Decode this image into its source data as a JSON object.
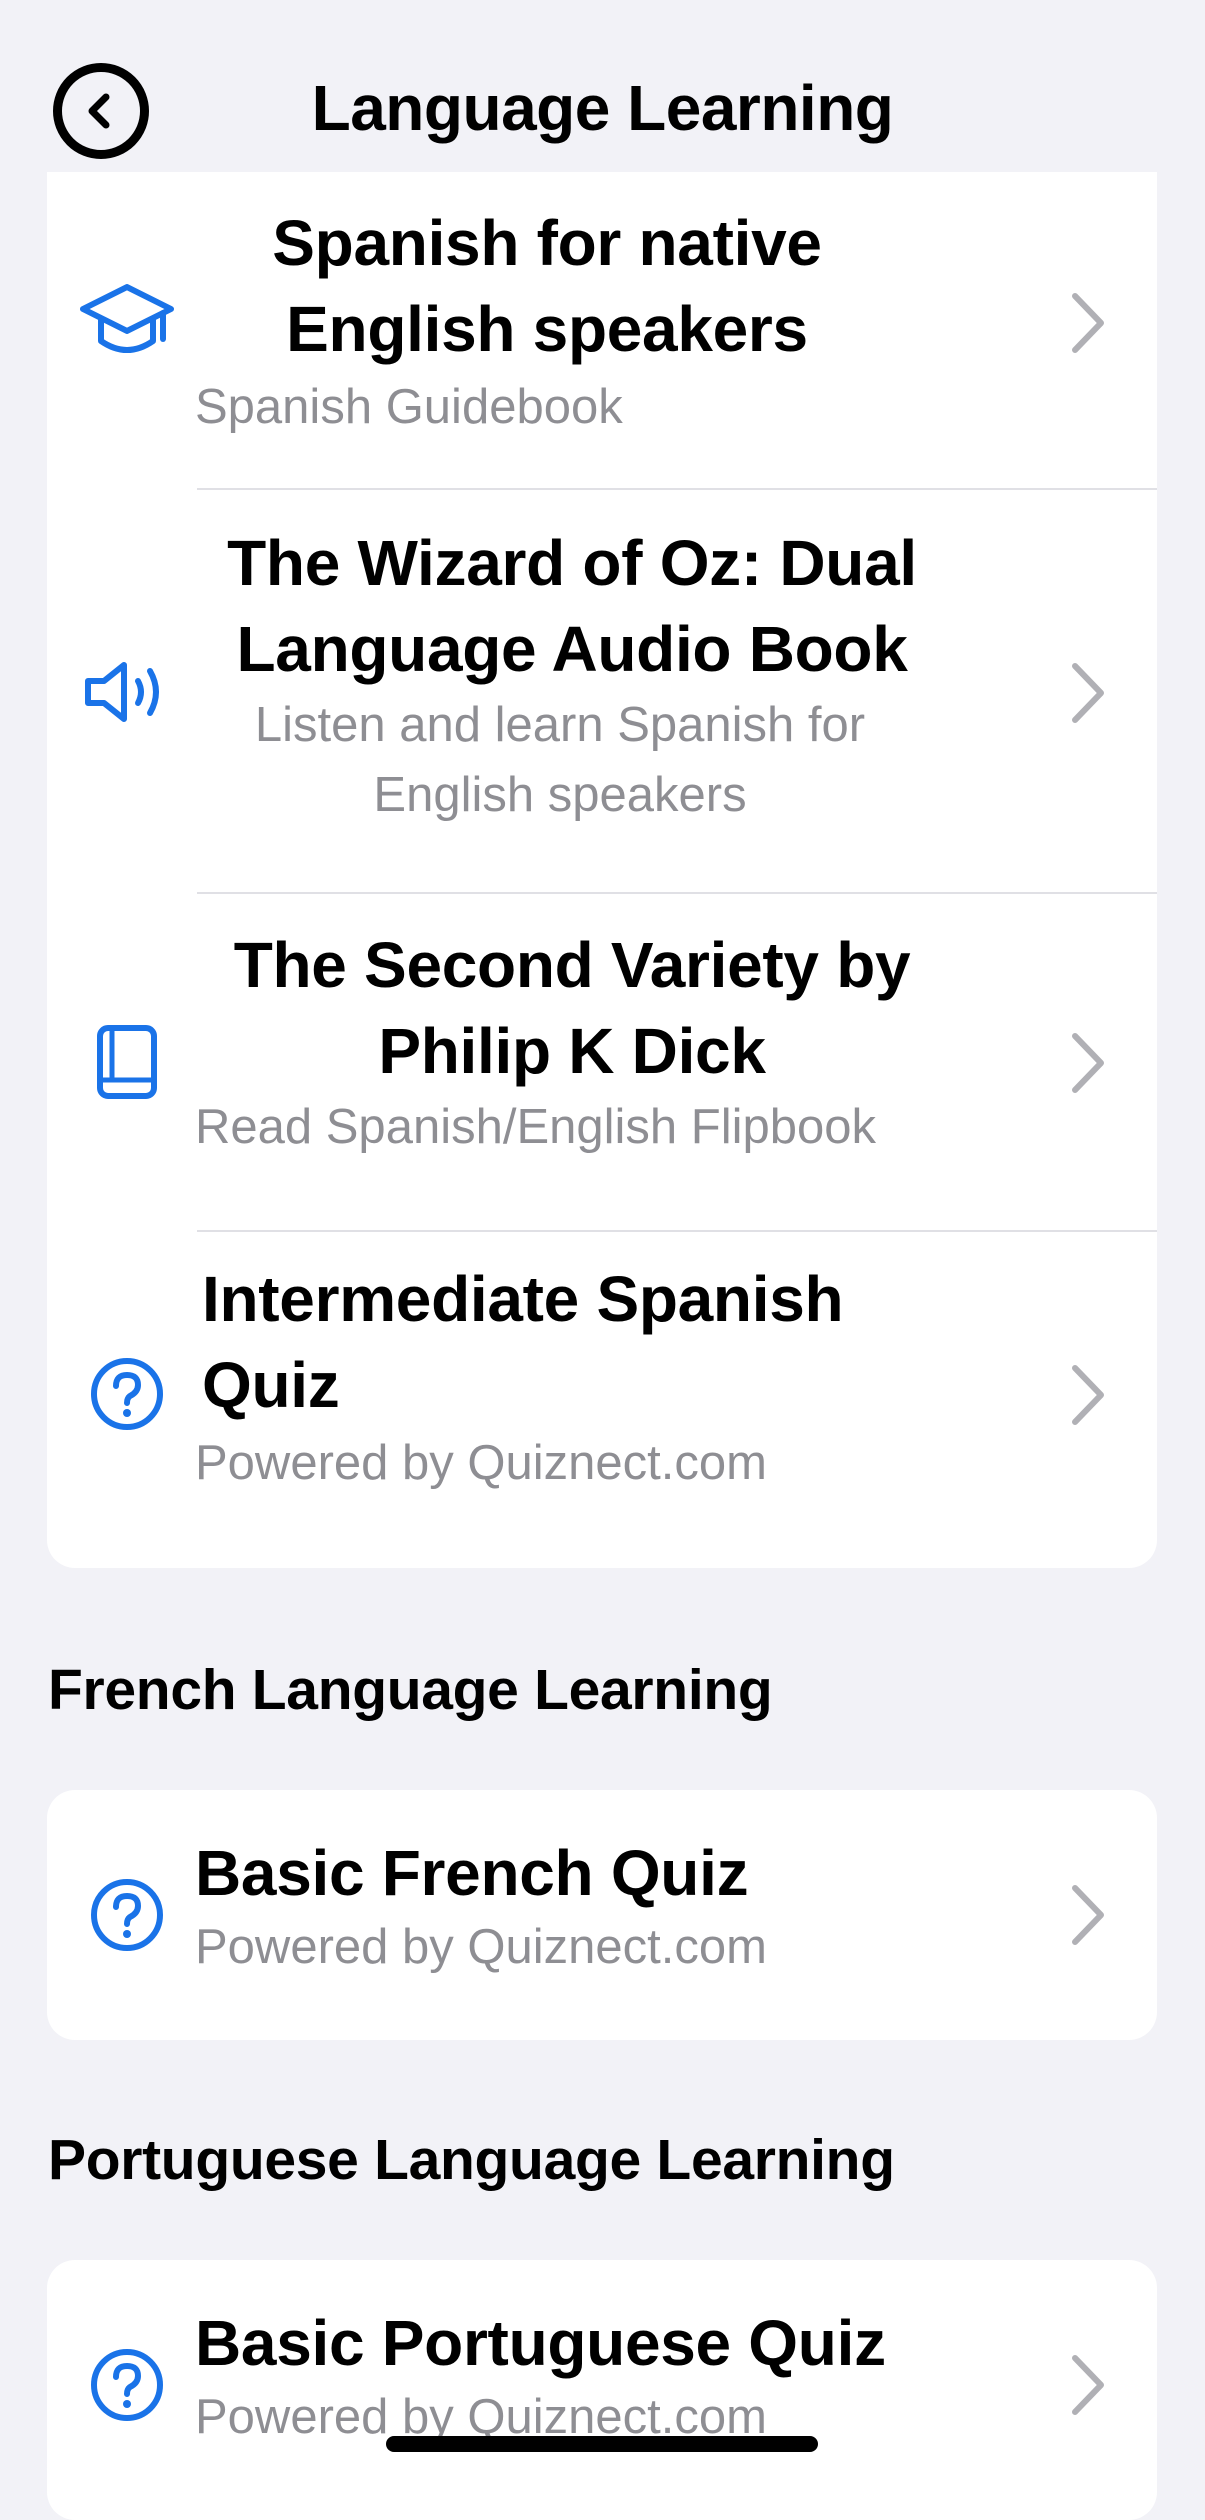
{
  "header": {
    "title": "Language Learning"
  },
  "spanish": {
    "items": [
      {
        "title": "Spanish for native English speakers",
        "subtitle": "Spanish Guidebook",
        "icon": "graduation-cap-icon"
      },
      {
        "title": "The Wizard of Oz: Dual Language Audio Book",
        "subtitle": "Listen and learn Spanish for English speakers",
        "icon": "speaker-icon"
      },
      {
        "title": "The Second Variety by Philip K Dick",
        "subtitle": "Read Spanish/English Flipbook",
        "icon": "book-icon"
      },
      {
        "title": "Intermediate Spanish Quiz",
        "subtitle": "Powered by Quiznect.com",
        "icon": "question-circle-icon"
      }
    ]
  },
  "french": {
    "section_title": "French Language Learning",
    "items": [
      {
        "title": "Basic French Quiz",
        "subtitle": "Powered by Quiznect.com",
        "icon": "question-circle-icon"
      }
    ]
  },
  "portuguese": {
    "section_title": "Portuguese Language Learning",
    "items": [
      {
        "title": "Basic Portuguese Quiz",
        "subtitle": "Powered by Quiznect.com",
        "icon": "question-circle-icon"
      }
    ]
  },
  "colors": {
    "accent": "#1a73e8",
    "chevron": "#b0b0b5",
    "secondary_text": "#8e8e93",
    "background": "#f2f2f7"
  }
}
